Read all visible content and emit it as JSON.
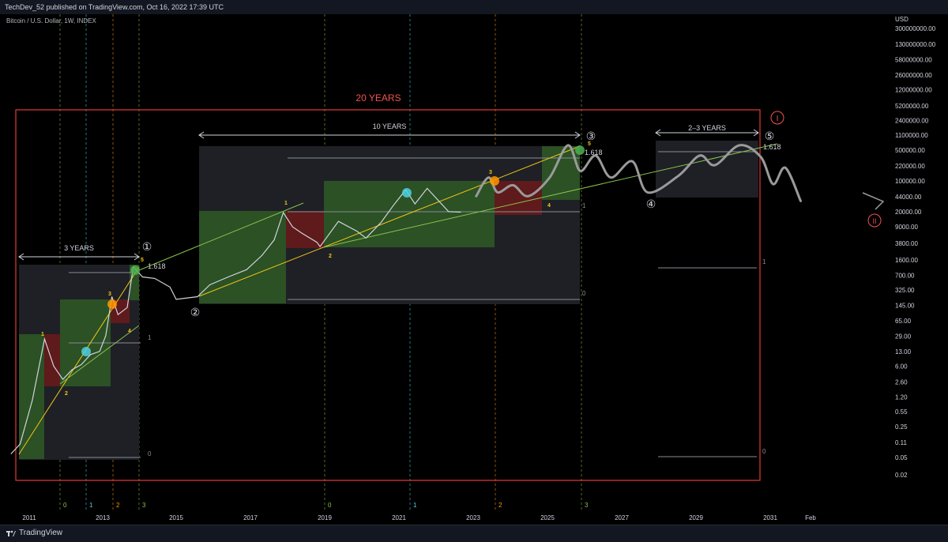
{
  "header": {
    "publish_line": "TechDev_52 published on TradingView.com, Oct 16, 2022 17:39 UTC"
  },
  "symbol_line": "Bitcoin / U.S. Dollar, 1W, INDEX",
  "footer": {
    "brand": "TradingView"
  },
  "chart_data": {
    "type": "line",
    "title": "Bitcoin / U.S. Dollar, 1W, INDEX",
    "y_axis_unit": "USD",
    "y_scale": "log",
    "y_ticks": [
      "300000000.00",
      "130000000.00",
      "58000000.00",
      "26000000.00",
      "12000000.00",
      "5200000.00",
      "2400000.00",
      "1100000.00",
      "500000.00",
      "220000.00",
      "100000.00",
      "44000.00",
      "20000.00",
      "9000.00",
      "3800.00",
      "1600.00",
      "700.00",
      "325.00",
      "145.00",
      "65.00",
      "29.00",
      "13.00",
      "6.00",
      "2.60",
      "1.20",
      "0.55",
      "0.25",
      "0.11",
      "0.05",
      "0.02"
    ],
    "x_ticks": [
      "2011",
      "2013",
      "2015",
      "2017",
      "2019",
      "2021",
      "2023",
      "2025",
      "2027",
      "2029",
      "2031",
      "Feb"
    ],
    "series": [
      {
        "type": "historical price",
        "points": [
          [
            "2010-07",
            0.06
          ],
          [
            "2010-10",
            0.1
          ],
          [
            "2011-02",
            1
          ],
          [
            "2011-06",
            25
          ],
          [
            "2011-09",
            6
          ],
          [
            "2011-12",
            3
          ],
          [
            "2012-03",
            5
          ],
          [
            "2012-06",
            6.5
          ],
          [
            "2012-09",
            11
          ],
          [
            "2012-12",
            13
          ],
          [
            "2013-02",
            30
          ],
          [
            "2013-04",
            230
          ],
          [
            "2013-06",
            90
          ],
          [
            "2013-09",
            130
          ],
          [
            "2013-11",
            1100
          ],
          [
            "2014-02",
            650
          ],
          [
            "2014-06",
            600
          ],
          [
            "2014-11",
            380
          ],
          [
            "2015-01",
            200
          ],
          [
            "2015-08",
            230
          ],
          [
            "2015-12",
            430
          ],
          [
            "2016-06",
            650
          ],
          [
            "2016-12",
            950
          ],
          [
            "2017-05",
            2000
          ],
          [
            "2017-09",
            4500
          ],
          [
            "2017-12",
            19000
          ],
          [
            "2018-03",
            9000
          ],
          [
            "2018-06",
            6500
          ],
          [
            "2018-11",
            4000
          ],
          [
            "2018-12",
            3200
          ],
          [
            "2019-06",
            12000
          ],
          [
            "2019-12",
            7200
          ],
          [
            "2020-03",
            5000
          ],
          [
            "2020-08",
            11500
          ],
          [
            "2020-12",
            28000
          ],
          [
            "2021-04",
            63000
          ],
          [
            "2021-07",
            30000
          ],
          [
            "2021-11",
            68000
          ],
          [
            "2022-06",
            20000
          ],
          [
            "2022-10",
            19500
          ]
        ]
      },
      {
        "type": "projection",
        "points": [
          [
            "2023-03",
            45000
          ],
          [
            "2023-07",
            120000
          ],
          [
            "2023-10",
            55000
          ],
          [
            "2024-03",
            80000
          ],
          [
            "2024-08",
            45000
          ],
          [
            "2025-03",
            120000
          ],
          [
            "2025-09",
            650000
          ],
          [
            "2026-01",
            170000
          ],
          [
            "2026-06",
            380000
          ],
          [
            "2026-11",
            120000
          ],
          [
            "2027-06",
            280000
          ],
          [
            "2027-11",
            55000
          ],
          [
            "2028-09",
            130000
          ],
          [
            "2029-04",
            380000
          ],
          [
            "2029-09",
            230000
          ],
          [
            "2030-05",
            650000
          ],
          [
            "2030-12",
            350000
          ],
          [
            "2031-04",
            85000
          ],
          [
            "2031-08",
            200000
          ],
          [
            "2032-01",
            35000
          ]
        ]
      }
    ],
    "annotations": [
      {
        "text": "20 YEARS",
        "color": "#ef5350"
      },
      {
        "text": "3 YEARS"
      },
      {
        "text": "10 YEARS"
      },
      {
        "text": "2–3 YEARS"
      },
      {
        "text": "1.618"
      },
      {
        "text": "1.618"
      },
      {
        "text": "1.618"
      },
      {
        "text": "①"
      },
      {
        "text": "②"
      },
      {
        "text": "③"
      },
      {
        "text": "④"
      },
      {
        "text": "⑤"
      },
      {
        "text": "I",
        "color": "#ef5350"
      },
      {
        "text": "II",
        "color": "#ef5350"
      }
    ],
    "wave_labels": [
      "1",
      "2",
      "3",
      "4",
      "5",
      "1",
      "2",
      "3",
      "4",
      "5"
    ],
    "fib_levels": [
      "0",
      "1",
      "0",
      "1",
      "0",
      "1"
    ],
    "cycle_markers": [
      "0",
      "1",
      "2",
      "3",
      "0",
      "1",
      "2",
      "3"
    ],
    "colors": {
      "price": "#d1d4dc",
      "green_box": "#2e5a26",
      "red_box": "#6b1a1a",
      "gray_box": "#1e2026",
      "frame": "#e53935",
      "trend_yellow": "#f5c518",
      "trend_green": "#8bc34a"
    }
  }
}
